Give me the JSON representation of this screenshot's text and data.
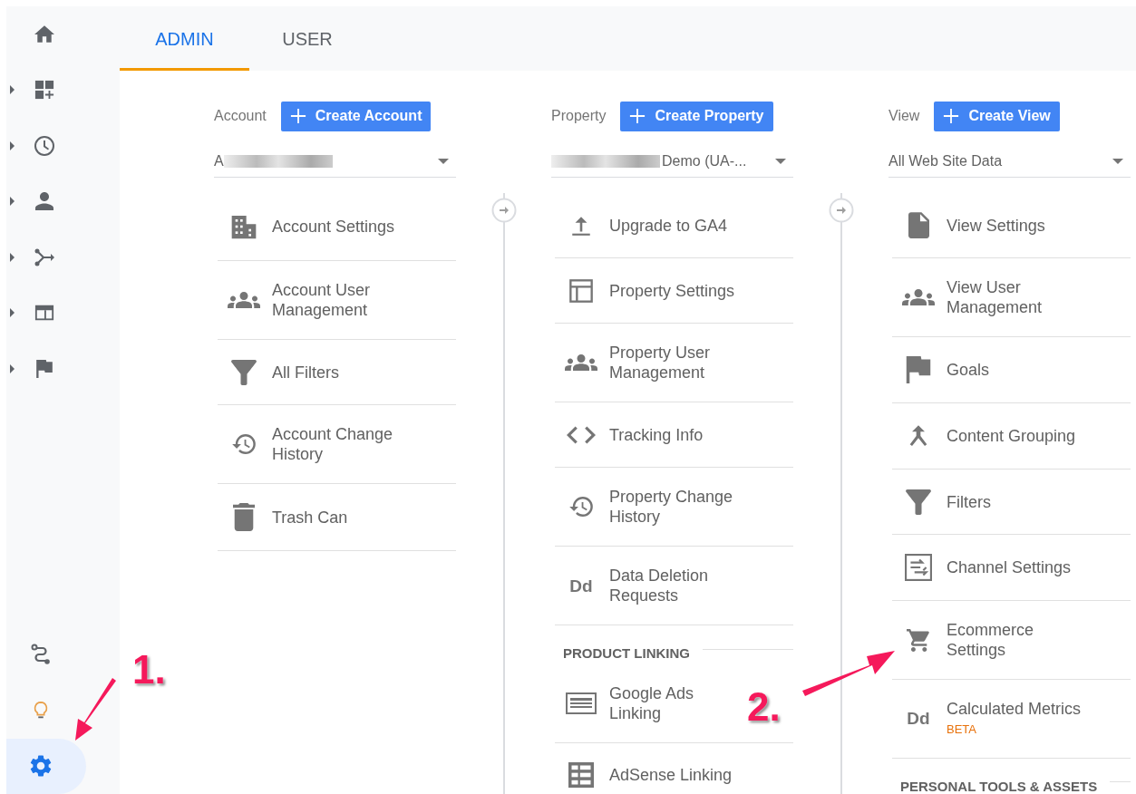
{
  "nav_top": [
    {
      "expandable": false
    },
    {
      "expandable": true
    },
    {
      "expandable": true
    },
    {
      "expandable": true
    },
    {
      "expandable": true
    },
    {
      "expandable": true
    },
    {
      "expandable": true
    }
  ],
  "nav_bottom": [
    {
      "selected": false
    },
    {
      "selected": false
    },
    {
      "selected": true
    }
  ],
  "tabs": [
    {
      "label": "ADMIN",
      "selected": true
    },
    {
      "label": "USER",
      "selected": false
    }
  ],
  "columns": [
    {
      "label": "Account",
      "button": "Create Account",
      "selector": {
        "text": "A",
        "blur_before": false,
        "blur_after": true
      },
      "items": [
        {
          "kind": "item",
          "label": "Account Settings"
        },
        {
          "kind": "item",
          "label": "Account User Management"
        },
        {
          "kind": "item",
          "label": "All Filters"
        },
        {
          "kind": "item",
          "label": "Account Change History"
        },
        {
          "kind": "item",
          "label": "Trash Can"
        }
      ]
    },
    {
      "label": "Property",
      "button": "Create Property",
      "selector": {
        "text": "Demo (UA-...",
        "blur_before": true,
        "blur_after": false
      },
      "items": [
        {
          "kind": "item",
          "label": "Upgrade to GA4"
        },
        {
          "kind": "item",
          "label": "Property Settings"
        },
        {
          "kind": "item",
          "label": "Property User Management"
        },
        {
          "kind": "item",
          "label": "Tracking Info"
        },
        {
          "kind": "item",
          "label": "Property Change History"
        },
        {
          "kind": "item",
          "label": "Data Deletion Requests",
          "icon_text": "Dd"
        },
        {
          "kind": "header",
          "label": "PRODUCT LINKING"
        },
        {
          "kind": "item",
          "label": "Google Ads Linking"
        },
        {
          "kind": "item",
          "label": "AdSense Linking"
        }
      ]
    },
    {
      "label": "View",
      "button": "Create View",
      "selector": {
        "text": "All Web Site Data",
        "blur_before": false,
        "blur_after": false
      },
      "items": [
        {
          "kind": "item",
          "label": "View Settings"
        },
        {
          "kind": "item",
          "label": "View User Management"
        },
        {
          "kind": "item",
          "label": "Goals"
        },
        {
          "kind": "item",
          "label": "Content Grouping"
        },
        {
          "kind": "item",
          "label": "Filters"
        },
        {
          "kind": "item",
          "label": "Channel Settings"
        },
        {
          "kind": "item",
          "label": "Ecommerce Settings"
        },
        {
          "kind": "item",
          "label": "Calculated Metrics",
          "icon_text": "Dd",
          "badge": "BETA"
        },
        {
          "kind": "header",
          "label": "PERSONAL TOOLS & ASSETS"
        }
      ]
    }
  ],
  "annotations": [
    "1.",
    "2."
  ]
}
